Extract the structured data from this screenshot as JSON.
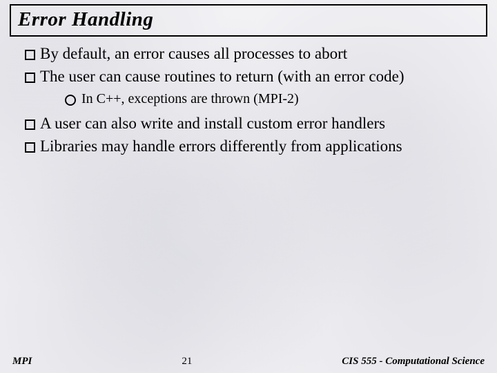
{
  "title": "Error Handling",
  "bullets": {
    "b1": "By default, an error causes all processes to abort",
    "b2": "The user can cause routines to return (with an error code)",
    "b2_sub1": "In C++, exceptions are thrown (MPI-2)",
    "b3": "A user can also write and install custom error handlers",
    "b4": "Libraries may handle errors differently from applications"
  },
  "footer": {
    "left": "MPI",
    "page": "21",
    "right": "CIS 555 - Computational Science"
  }
}
